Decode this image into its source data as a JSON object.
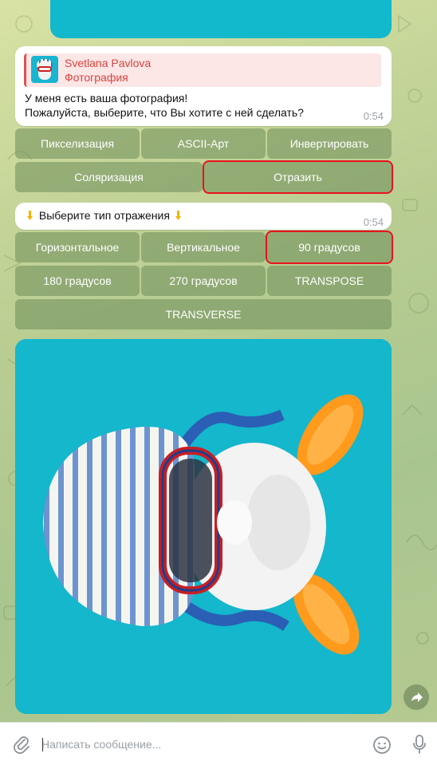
{
  "reply": {
    "name": "Svetlana Pavlova",
    "subtitle": "Фотография"
  },
  "message1": {
    "text": "У меня есть ваша фотография!\nПожалуйста, выберите, что Вы хотите с ней сделать?",
    "time": "0:54"
  },
  "keyboard1": [
    {
      "label": "Пикселизация"
    },
    {
      "label": "ASCII-Арт"
    },
    {
      "label": "Инвертировать"
    },
    {
      "label": "Соляризация"
    },
    {
      "label": "Отразить",
      "highlighted": true
    }
  ],
  "message2": {
    "text": "Выберите тип отражения",
    "emoji": "pointing-down-hand",
    "time": "0:54"
  },
  "keyboard2": [
    {
      "label": "Горизонтальное"
    },
    {
      "label": "Вертикальное"
    },
    {
      "label": "90 градусов",
      "highlighted": true
    },
    {
      "label": "180 градусов"
    },
    {
      "label": "270 градусов"
    },
    {
      "label": "TRANSPOSE"
    },
    {
      "label": "TRANSVERSE"
    }
  ],
  "input": {
    "placeholder": "Написать сообщение..."
  },
  "colors": {
    "accent_red": "#e0514e",
    "highlight": "#e8121e",
    "photo_bg": "#14b7cc",
    "button_bg": "#6e8c5a"
  },
  "icons": {
    "attach": "paperclip-icon",
    "emoji": "smile-icon",
    "voice": "microphone-icon",
    "forward": "share-arrow-icon"
  }
}
